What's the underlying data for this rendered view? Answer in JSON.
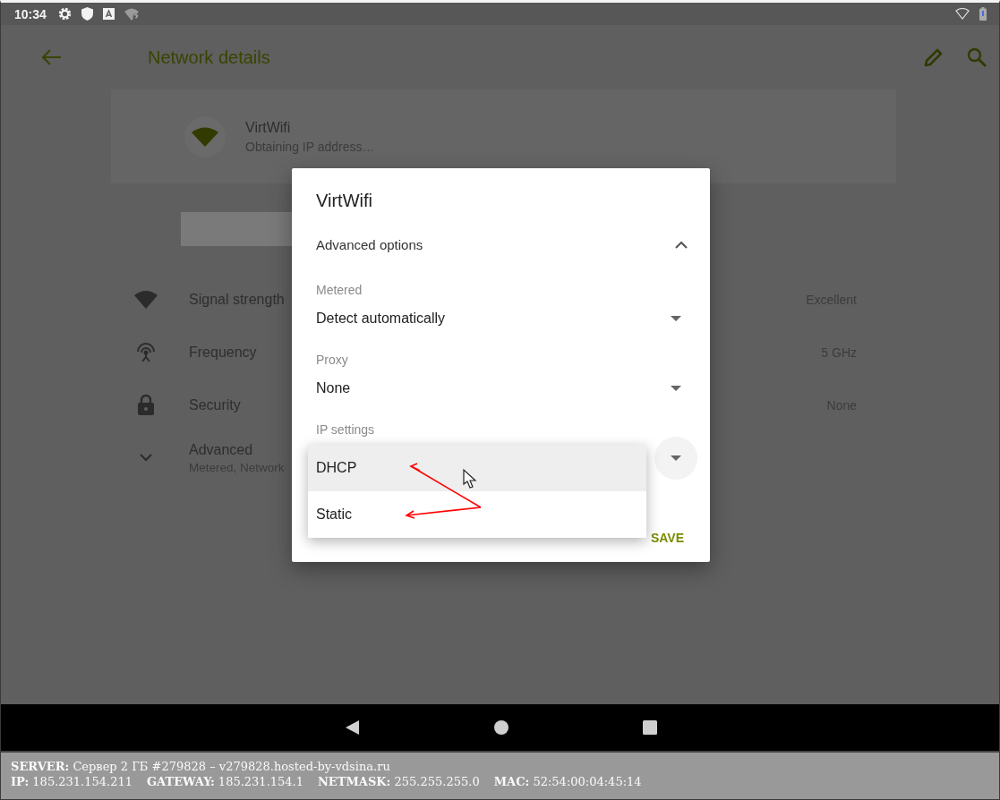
{
  "status_bar": {
    "time": "10:34"
  },
  "app_bar": {
    "title": "Network details"
  },
  "network": {
    "name": "VirtWifi",
    "status": "Obtaining IP address…"
  },
  "details": [
    {
      "kind": "signal",
      "label": "Signal strength",
      "value": "Excellent"
    },
    {
      "kind": "frequency",
      "label": "Frequency",
      "value": "5 GHz"
    },
    {
      "kind": "security",
      "label": "Security",
      "value": "None"
    },
    {
      "kind": "advanced",
      "label": "Advanced",
      "summary": "Metered, Network",
      "expanded": false
    }
  ],
  "dialog": {
    "title": "VirtWifi",
    "section": {
      "label": "Advanced options",
      "expanded": true
    },
    "fields": [
      {
        "label": "Metered",
        "value": "Detect automatically"
      },
      {
        "label": "Proxy",
        "value": "None"
      },
      {
        "label": "IP settings"
      }
    ],
    "buttons": [
      {
        "label": "SAVE",
        "kind": "primary"
      }
    ]
  },
  "dropdown": [
    {
      "label": "DHCP",
      "selected": true
    },
    {
      "label": "Static",
      "selected": false
    }
  ],
  "server_info": [
    [
      "**SERVER:** Сервер 2 ГБ #279828 – v279828.hosted-by-vdsina.ru"
    ],
    [
      "**IP:** 185.231.154.211",
      "**GATEWAY:** 185.231.154.1",
      "**NETMASK:** 255.255.255.0",
      "**MAC:** 52:54:00:04:45:14"
    ]
  ]
}
